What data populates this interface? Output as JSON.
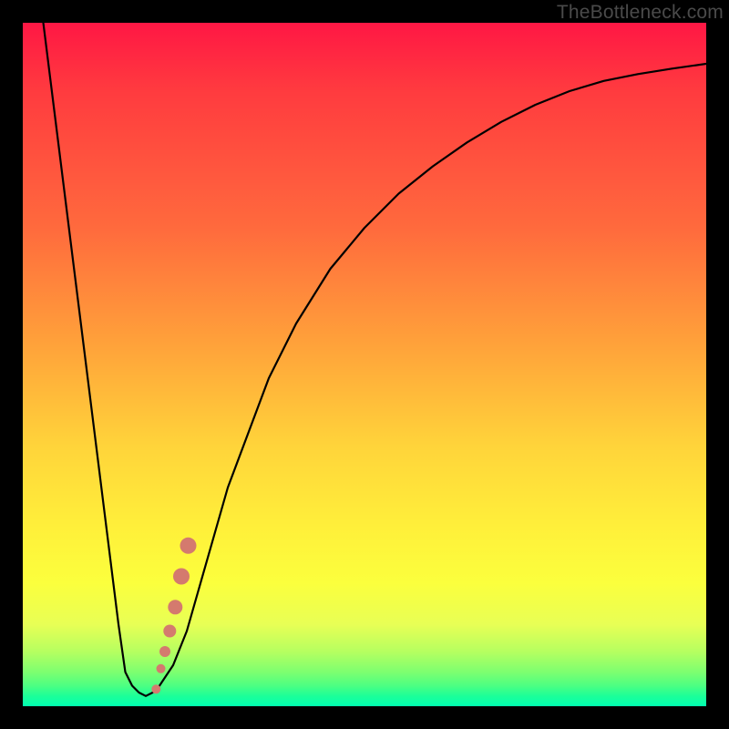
{
  "watermark": "TheBottleneck.com",
  "chart_data": {
    "type": "line",
    "title": "",
    "xlabel": "",
    "ylabel": "",
    "xlim": [
      0,
      100
    ],
    "ylim": [
      0,
      100
    ],
    "grid": false,
    "legend": false,
    "series": [
      {
        "name": "bottleneck-curve",
        "x": [
          3,
          4,
          5,
          6,
          7,
          8,
          9,
          10,
          11,
          12,
          13,
          14,
          15,
          16,
          17,
          18,
          19,
          20,
          22,
          24,
          26,
          28,
          30,
          33,
          36,
          40,
          45,
          50,
          55,
          60,
          65,
          70,
          75,
          80,
          85,
          90,
          95,
          100
        ],
        "y": [
          100,
          92,
          84,
          76,
          68,
          60,
          52,
          44,
          36,
          28,
          20,
          12,
          5,
          3,
          2,
          1.5,
          2,
          3,
          6,
          11,
          18,
          25,
          32,
          40,
          48,
          56,
          64,
          70,
          75,
          79,
          82.5,
          85.5,
          88,
          90,
          91.5,
          92.5,
          93.3,
          94
        ]
      }
    ],
    "highlight_points": {
      "name": "exclamation-dots",
      "color": "#d47a6e",
      "points": [
        {
          "x": 19.5,
          "y": 2.5,
          "r": 5
        },
        {
          "x": 20.2,
          "y": 5.5,
          "r": 5
        },
        {
          "x": 20.8,
          "y": 8.0,
          "r": 6
        },
        {
          "x": 21.5,
          "y": 11.0,
          "r": 7
        },
        {
          "x": 22.3,
          "y": 14.5,
          "r": 8
        },
        {
          "x": 23.2,
          "y": 19.0,
          "r": 9
        },
        {
          "x": 24.2,
          "y": 23.5,
          "r": 9
        }
      ]
    },
    "gradient_stops": [
      {
        "pos": 0,
        "color": "#ff1744"
      },
      {
        "pos": 30,
        "color": "#ff6a3d"
      },
      {
        "pos": 62,
        "color": "#ffd43a"
      },
      {
        "pos": 82,
        "color": "#fbff3d"
      },
      {
        "pos": 95,
        "color": "#7dff70"
      },
      {
        "pos": 100,
        "color": "#00ffb0"
      }
    ]
  }
}
